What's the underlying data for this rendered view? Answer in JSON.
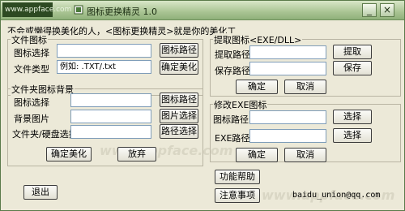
{
  "titlebar": {
    "site": "www.appface.com",
    "title": "图标更换精灵 1.0",
    "minimize_glyph": "_",
    "close_glyph": "×"
  },
  "watermark": "www.appface.com",
  "intro": "不会或懒得换美化的人，<图标更换精灵>就是你的美化工",
  "file_icon": {
    "legend": "文件图标",
    "icon_select_label": "图标选择",
    "icon_path_button": "图标路径",
    "file_type_label": "文件类型",
    "file_type_value": "例如: .TXT/.txt",
    "confirm_button": "确定美化"
  },
  "folder_bg": {
    "legend": "文件夹图标背景",
    "icon_select_label": "图标选择",
    "icon_path_button": "图标路径",
    "bg_image_label": "背景图片",
    "image_select_button": "图片选择",
    "folder_disk_label": "文件夹/硬盘选择",
    "path_select_button": "路径选择",
    "confirm_button": "确定美化",
    "discard_button": "放弃"
  },
  "extract": {
    "legend": "提取图标<EXE/DLL>",
    "extract_path_label": "提取路径",
    "extract_button": "提取",
    "save_path_label": "保存路径",
    "save_button": "保存",
    "ok_button": "确定",
    "cancel_button": "取消"
  },
  "modify_exe": {
    "legend": "修改EXE图标",
    "icon_path_label": "图标路径",
    "select_button_1": "选择",
    "exe_path_label": "EXE路径",
    "select_button_2": "选择",
    "ok_button": "确定",
    "cancel_button": "取消"
  },
  "footer": {
    "exit_button": "退出",
    "help_button": "功能帮助",
    "notes_button": "注意事项",
    "email": "baidu_union@qq.com"
  }
}
